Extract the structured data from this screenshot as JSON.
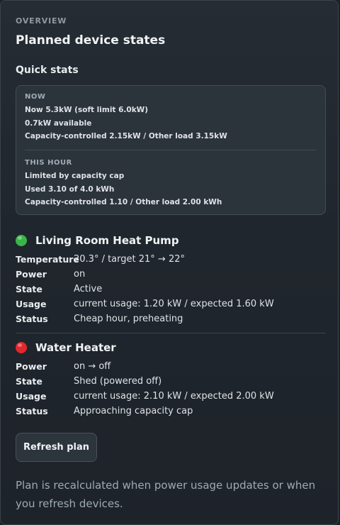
{
  "header": {
    "eyebrow": "OVERVIEW",
    "title": "Planned device states"
  },
  "quick_stats": {
    "heading": "Quick stats",
    "now": {
      "label": "NOW",
      "lines": [
        "Now 5.3kW (soft limit 6.0kW)",
        "0.7kW available",
        "Capacity-controlled 2.15kW / Other load 3.15kW"
      ]
    },
    "this_hour": {
      "label": "THIS HOUR",
      "lines": [
        "Limited by capacity cap",
        "Used 3.10 of 4.0 kWh",
        "Capacity-controlled 1.10 / Other load 2.00 kWh"
      ]
    }
  },
  "devices": [
    {
      "name": "Living Room Heat Pump",
      "status_color": "#39b54a",
      "rows": [
        {
          "key": "Temperature",
          "value": "20.3° / target 21° → 22°"
        },
        {
          "key": "Power",
          "value": "on"
        },
        {
          "key": "State",
          "value": "Active"
        },
        {
          "key": "Usage",
          "value": "current usage: 1.20 kW / expected 1.60 kW"
        },
        {
          "key": "Status",
          "value": "Cheap hour, preheating"
        }
      ]
    },
    {
      "name": "Water Heater",
      "status_color": "#e0282e",
      "rows": [
        {
          "key": "Power",
          "value": "on → off"
        },
        {
          "key": "State",
          "value": "Shed (powered off)"
        },
        {
          "key": "Usage",
          "value": "current usage: 2.10 kW / expected 2.00 kW"
        },
        {
          "key": "Status",
          "value": "Approaching capacity cap"
        }
      ]
    }
  ],
  "actions": {
    "refresh_label": "Refresh plan"
  },
  "footer_note": "Plan is recalculated when power usage updates or when you refresh devices."
}
